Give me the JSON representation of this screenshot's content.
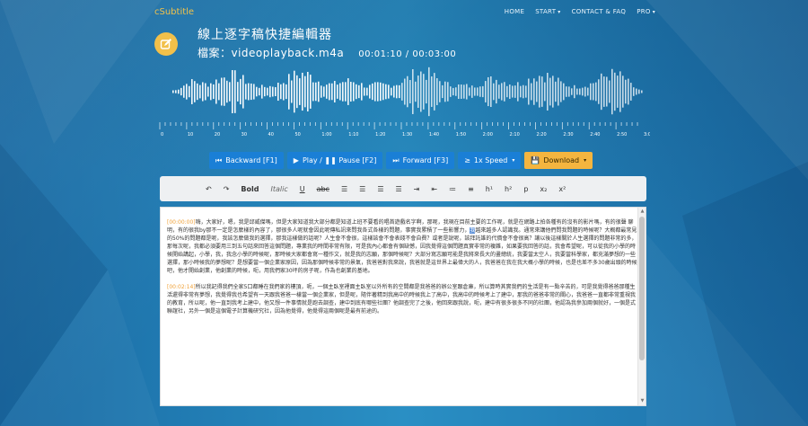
{
  "nav": {
    "brand": "cSubtitle",
    "items": [
      {
        "label": "HOME",
        "dropdown": false
      },
      {
        "label": "START",
        "dropdown": true
      },
      {
        "label": "CONTACT & FAQ",
        "dropdown": false
      },
      {
        "label": "PRO",
        "dropdown": true
      }
    ]
  },
  "header": {
    "title": "線上逐字稿快捷編輯器",
    "file_label": "檔案：videoplayback.m4a",
    "time_display": "00:01:10 / 00:03:00"
  },
  "timeline": {
    "ticks": [
      "0",
      "10",
      "20",
      "30",
      "40",
      "50",
      "1:00",
      "1:10",
      "1:20",
      "1:30",
      "1:40",
      "1:50",
      "2:00",
      "2:10",
      "2:20",
      "2:30",
      "2:40",
      "2:50",
      "3:00"
    ]
  },
  "controls": {
    "backward": "Backward [F1]",
    "play_pause": "Play / ❚❚ Pause [F2]",
    "forward": "Forward [F3]",
    "speed": "1x Speed",
    "download": "Download"
  },
  "editor_toolbar": {
    "bold": "Bold",
    "italic": "Italic",
    "underline": "U",
    "strike": "abc",
    "h1": "h¹",
    "h2": "h²",
    "p": "p",
    "sub": "x₂",
    "sup": "x²"
  },
  "transcript": [
    {
      "timestamp": "[00:00:00]",
      "text_before": "嗨，大家好，嗯，我是邱威傑嗎，但是大家知道我大部分都是知道上班不要看的唱首遊戲名字啊，那呢，我現在目前主要的工作呢，就是在網路上拍各種有的沒有的影片嗎，有的很聲 聊明，有的很我by那不一定是怎麼樣的內容了，那很多人呢就會因此呢傳私訊來問我各式各樣的問題，事實我累積了一些影響力，",
      "highlight": "我",
      "text_after": "越來越多人認識我。通常來講他們問我問題的時候呢？大概都最常見的50%的問題都是呢，我該怎麼做我的選擇，那我這樣做的話呢？人生會不會很，這樣該會不會表錢不會自費？或者是說呢，該拜託誰的代價會不會很高？讓以後這樣關於人生選擇的問題非常的多，那每次呢，我都必須要用三到五句話來回答這個問題，專業我的時間非常有限，可是我內心都會有個缺憾，因我覺得這個問題真實非常的複雜，如果要我回答的話，我會希望呢，可以從我的小學的時候開始講起，小學，我，我念小學的時候呢，那時候大家都會寫一種作文，就是我的志願，那個時候呢？大部分寫志願可能是我將來長大的畫總統，我要當太空人，我要當科學家，都充滿夢想的一些選擇，那小時候我的夢想呢？是想要當一個企業家原因，因為那個時候非常的景氣，我爸爸對我來說，我爸就是這世界上最偉大的人，我爸爸在我在我大概小學的時候，也是也差不多30歲出頭的時候吧，他才開始創業，他創業的時候，呃，用我們家30坪的房子呢，作為也創業的基地。"
    },
    {
      "timestamp": "[00:02:14]",
      "text_before": "所以我記得我們全家5口都睡在我們家的樓頂，呃，一個主臥室裡面主臥室以外所有的空間都是我爸爸的辦公室跟倉庫，所以算時其實我們的生活是有一點辛苦的，可是我覺得爸爸那種生活還得非常有夢想，我覺得我也希望有一天跟我爸爸一樣當一個企業家，但是呢，隨伴著精到我高中的時候我上了高中，我高中的時候考上了建中，那我的爸爸非常的關心，我爸爸一直都非常重視我的教育，所以呢，他一直到我考上建中，他又想一件事情就是跑去調查，建中到底有哪些社團？他調查完了之後，他回來跟我說，呃，建中有很多很多不同的社團，他認為我參加兩個就好，一個是式聯誼社，另外一個是這個電子計算機研究社，因為他覺得，他覺得這兩個呢是最有前途的。",
      "highlight": "",
      "text_after": ""
    }
  ],
  "colors": {
    "accent": "#1a7fd6",
    "download": "#f4b53f",
    "brand": "#f1c24b",
    "timestamp": "#f0a23a"
  }
}
